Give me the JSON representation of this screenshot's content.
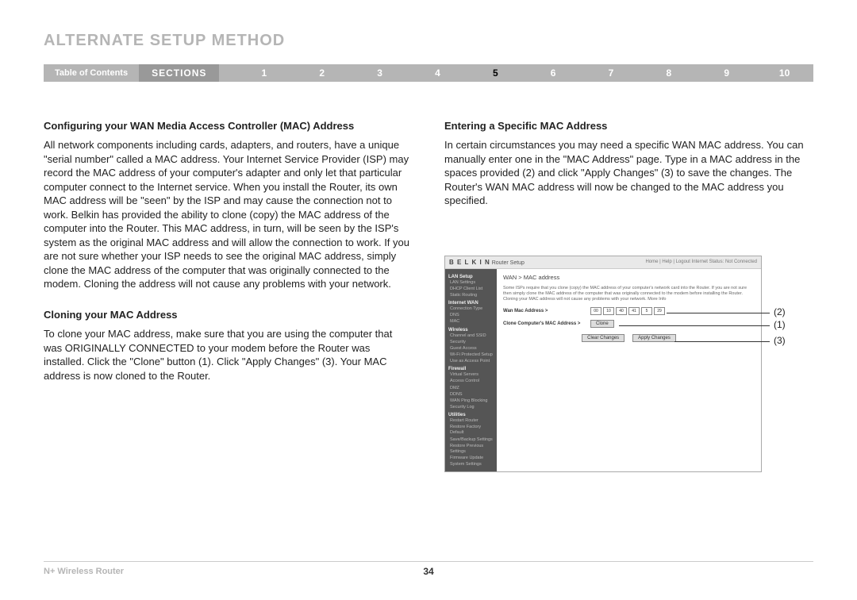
{
  "page": {
    "title": "ALTERNATE SETUP METHOD",
    "toc_label": "Table of Contents",
    "sections_label": "SECTIONS",
    "section_tabs": [
      "1",
      "2",
      "3",
      "4",
      "5",
      "6",
      "7",
      "8",
      "9",
      "10"
    ],
    "active_section": "5",
    "footer_product": "N+ Wireless Router",
    "page_number": "34"
  },
  "left": {
    "h1": "Configuring your WAN Media Access Controller (MAC) Address",
    "p1": "All network components including cards, adapters, and routers, have a unique \"serial number\" called a MAC address. Your Internet Service Provider (ISP) may record the MAC address of your computer's adapter and only let that particular computer connect to the Internet service. When you install the Router, its own MAC address will be \"seen\" by the ISP and may cause the connection not to work. Belkin has provided the ability to clone (copy) the MAC address of the computer into the Router. This MAC address, in turn, will be seen by the ISP's system as the original MAC address and will allow the connection to work. If you are not sure whether your ISP needs to see the original MAC address, simply clone the MAC address of the computer that was originally connected to the modem. Cloning the address will not cause any problems with your network.",
    "h2": "Cloning your MAC Address",
    "p2": "To clone your MAC address, make sure that you are using the computer that was ORIGINALLY CONNECTED to your modem before the Router was installed. Click the \"Clone\" button (1). Click \"Apply Changes\" (3). Your MAC address is now cloned to the Router."
  },
  "right": {
    "h1": "Entering a Specific MAC Address",
    "p1": "In certain circumstances you may need a specific WAN MAC address. You can manually enter one in the \"MAC Address\" page. Type in a MAC address in the spaces provided (2) and click \"Apply Changes\" (3) to save the changes. The Router's WAN MAC address will now be changed to the MAC address you specified."
  },
  "router": {
    "brand": "B E L K I N",
    "title": "Router Setup",
    "status": "Home | Help | Logout   Internet Status: Not Connected",
    "breadcrumb": "WAN > MAC address",
    "help": "Some ISPs require that you clone (copy) the MAC address of your computer's network card into the Router. If you are not sure then simply clone the MAC address of the computer that was originally connected to the modem before installing the Router. Cloning your MAC address will not cause any problems with your network. More Info",
    "mac_label": "Wan Mac Address >",
    "mac_values": [
      "00",
      "10",
      "40",
      "41",
      "5",
      "29"
    ],
    "clone_label": "Clone Computer's MAC Address >",
    "clone_btn": "Clone",
    "clear_btn": "Clear Changes",
    "apply_btn": "Apply Changes",
    "sidebar": {
      "g1": "LAN Setup",
      "g1_items": [
        "LAN Settings",
        "DHCP Client List",
        "Static Routing"
      ],
      "g2": "Internet WAN",
      "g2_items": [
        "Connection Type",
        "DNS",
        "MAC"
      ],
      "g3": "Wireless",
      "g3_items": [
        "Channel and SSID",
        "Security",
        "Guest Access",
        "Wi-Fi Protected Setup",
        "Use as Access Point"
      ],
      "g4": "Firewall",
      "g4_items": [
        "Virtual Servers",
        "Access Control",
        "DMZ",
        "DDNS",
        "WAN Ping Blocking",
        "Security Log"
      ],
      "g5": "Utilities",
      "g5_items": [
        "Restart Router",
        "Restore Factory Default",
        "Save/Backup Settings",
        "Restore Previous Settings",
        "Firmware Update",
        "System Settings"
      ]
    }
  },
  "callouts": {
    "c1": "(1)",
    "c2": "(2)",
    "c3": "(3)"
  }
}
